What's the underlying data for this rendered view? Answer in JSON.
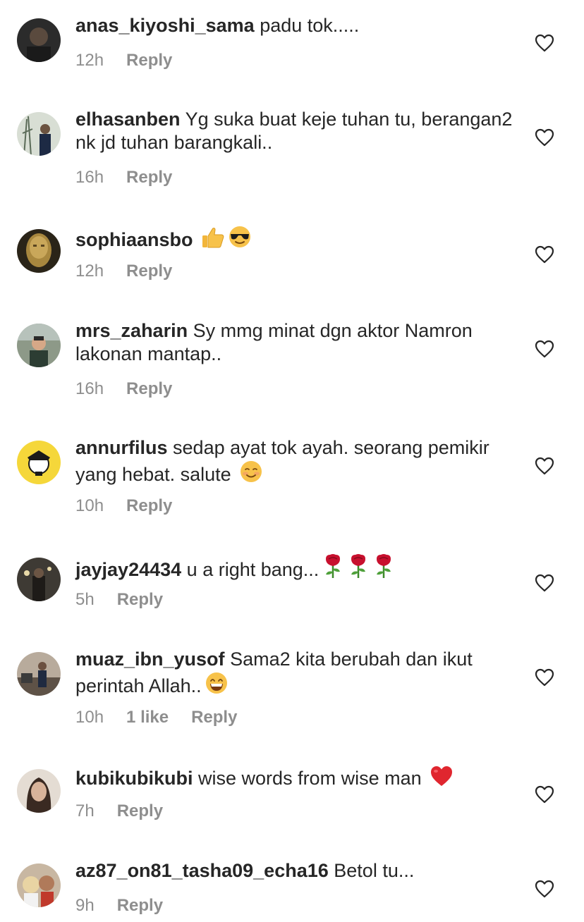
{
  "comments": [
    {
      "username": "anas_kiyoshi_sama",
      "text": "padu tok.....",
      "time": "12h",
      "likes": "",
      "reply": "Reply",
      "avatar_color": "#2b2b2b",
      "icons": []
    },
    {
      "username": "elhasanben",
      "text": "Yg suka buat keje tuhan tu, berangan2 nk jd tuhan barangkali..",
      "time": "16h",
      "likes": "",
      "reply": "Reply",
      "avatar_color": "#d8ded4",
      "icons": []
    },
    {
      "username": "sophiaansbo",
      "text": "",
      "time": "12h",
      "likes": "",
      "reply": "Reply",
      "avatar_color": "#7a6228",
      "icons": [
        "thumbs-up-emoji",
        "sunglasses-face-emoji"
      ]
    },
    {
      "username": "mrs_zaharin",
      "text": "Sy mmg minat dgn aktor Namron lakonan mantap..",
      "time": "16h",
      "likes": "",
      "reply": "Reply",
      "avatar_color": "#6d7a6a",
      "icons": []
    },
    {
      "username": "annurfilus",
      "text": "sedap ayat tok ayah. seorang pemikir yang hebat. salute",
      "time": "10h",
      "likes": "",
      "reply": "Reply",
      "avatar_color": "#f5d73a",
      "icons": [
        "smiling-face-emoji"
      ]
    },
    {
      "username": "jayjay24434",
      "text": "u a right bang...",
      "time": "5h",
      "likes": "",
      "reply": "Reply",
      "avatar_color": "#3e3a34",
      "icons": [
        "rose-emoji",
        "rose-emoji",
        "rose-emoji"
      ]
    },
    {
      "username": "muaz_ibn_yusof",
      "text": "Sama2 kita berubah dan ikut perintah Allah..",
      "time": "10h",
      "likes": "1 like",
      "reply": "Reply",
      "avatar_color": "#8a7a6a",
      "icons": [
        "grinning-face-emoji"
      ]
    },
    {
      "username": "kubikubikubi",
      "text": "wise words from wise man",
      "time": "7h",
      "likes": "",
      "reply": "Reply",
      "avatar_color": "#c9b7a6",
      "icons": [
        "red-heart-emoji"
      ]
    },
    {
      "username": "az87_on81_tasha09_echa16",
      "text": "Betol tu...",
      "time": "9h",
      "likes": "",
      "reply": "Reply",
      "avatar_color": "#b49a7e",
      "icons": []
    }
  ],
  "colors": {
    "text": "#262626",
    "meta": "#8e8e8e",
    "heart_outline": "#262626"
  },
  "icon_names": {
    "like": "heart-outline-icon"
  }
}
